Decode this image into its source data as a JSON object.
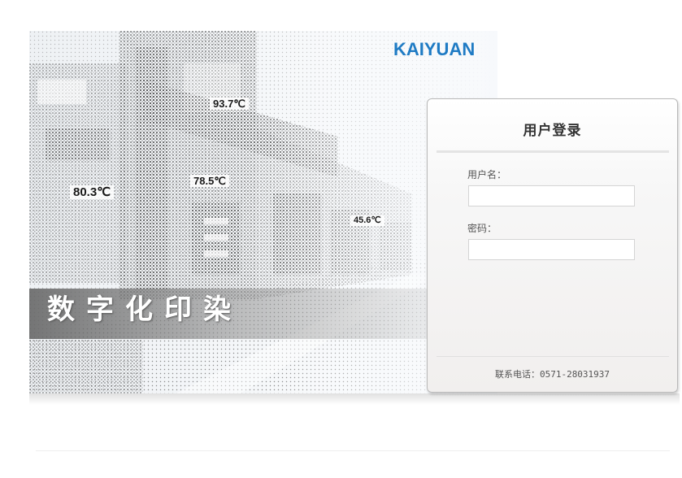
{
  "banner": {
    "brand": "KAIYUAN",
    "slogan": "数字化印染",
    "temperatures": [
      "93.7℃",
      "80.3℃",
      "78.5℃",
      "45.6℃"
    ]
  },
  "login": {
    "title": "用户登录",
    "username_label": "用户名：",
    "username_value": "",
    "password_label": "密码：",
    "password_value": "",
    "contact_label": "联系电话：",
    "contact_phone": "0571-28031937"
  },
  "colors": {
    "brand_blue": "#1f7bc4",
    "panel_border": "#b9b9b9",
    "text_dark": "#333333"
  }
}
